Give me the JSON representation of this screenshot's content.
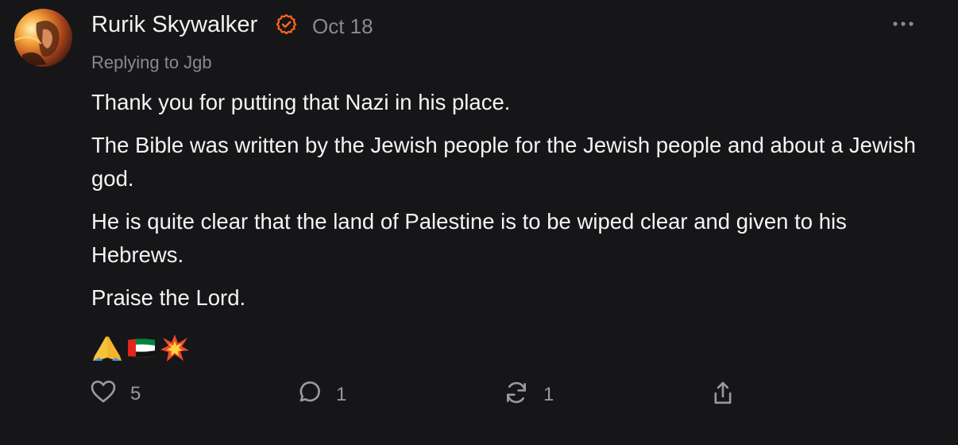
{
  "post": {
    "author": "Rurik Skywalker",
    "date": "Oct 18",
    "replying_to": "Replying to Jgb",
    "paragraphs": [
      "Thank you for putting that Nazi in his place.",
      "The Bible was written by the Jewish people for the Jewish people and about a Jewish god.",
      "He is quite clear that the land of Palestine is to be wiped clear and given to his Hebrews.",
      "Praise the Lord."
    ],
    "emojis": [
      "pray-emoji",
      "uae-flag-emoji",
      "collision-emoji"
    ]
  },
  "actions": {
    "likes": "5",
    "comments": "1",
    "restacks": "1"
  },
  "colors": {
    "background": "#161618",
    "text": "#f4f4f4",
    "muted": "#8a8a8e",
    "badge": "#ff6719"
  },
  "icons": [
    "avatar",
    "verified-badge-icon",
    "more-options-icon",
    "heart-icon",
    "comment-icon",
    "restack-icon",
    "share-icon"
  ]
}
